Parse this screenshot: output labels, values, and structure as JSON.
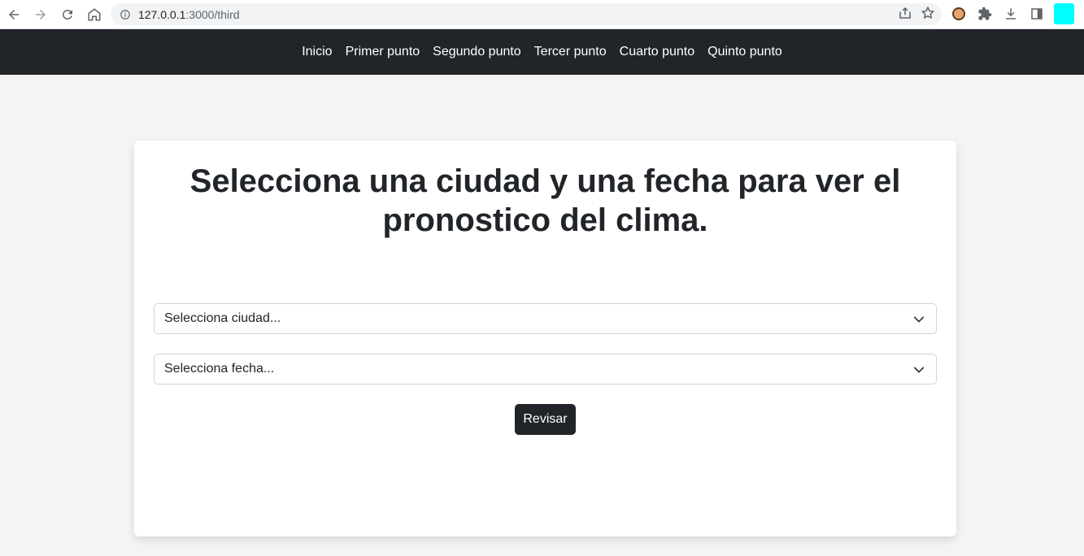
{
  "browser": {
    "url_host": "127.0.0.1",
    "url_rest": ":3000/third"
  },
  "navbar": {
    "items": [
      {
        "label": "Inicio"
      },
      {
        "label": "Primer punto"
      },
      {
        "label": "Segundo punto"
      },
      {
        "label": "Tercer punto"
      },
      {
        "label": "Cuarto punto"
      },
      {
        "label": "Quinto punto"
      }
    ]
  },
  "main": {
    "title": "Selecciona una ciudad y una fecha para ver el pronostico del clima.",
    "city_select": {
      "value": "Selecciona ciudad..."
    },
    "date_select": {
      "value": "Selecciona fecha..."
    },
    "submit_label": "Revisar"
  },
  "colors": {
    "navbar_bg": "#212529",
    "page_bg": "#f4f4f4",
    "button_bg": "#212529",
    "profile_accent": "#00ffff"
  },
  "icons": [
    "back-icon",
    "forward-icon",
    "reload-icon",
    "home-icon",
    "info-icon",
    "share-icon",
    "star-icon",
    "extension-avatar-icon",
    "puzzle-icon",
    "download-icon",
    "sidebar-icon",
    "chevron-down-icon"
  ]
}
